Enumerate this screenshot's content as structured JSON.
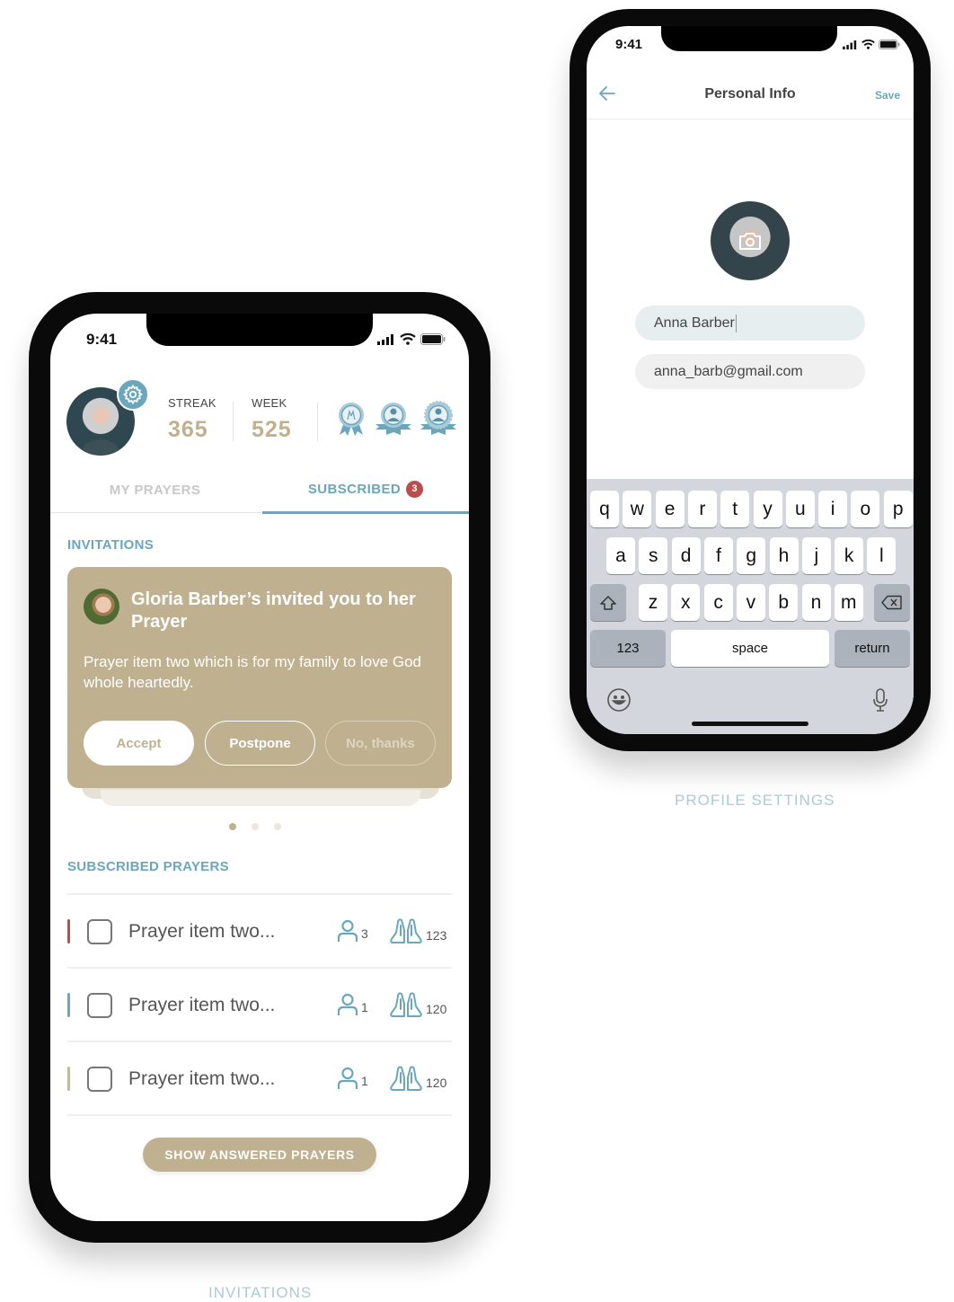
{
  "colors": {
    "accent": "#6aa7bd",
    "gold": "#bfb090",
    "badge_red": "#b84f4c"
  },
  "invitations_screen": {
    "caption": "INVITATIONS",
    "status": {
      "time": "9:41"
    },
    "profile": {
      "settings_icon": "gear-icon",
      "streak_label": "STREAK",
      "streak_value": "365",
      "week_label": "WEEK",
      "week_value": "525",
      "achievements": [
        "praying-hands-medal",
        "person-2-medal",
        "person-12-medal"
      ]
    },
    "tabs": [
      {
        "label": "MY PRAYERS",
        "active": false
      },
      {
        "label": "SUBSCRIBED",
        "active": true,
        "badge": "3"
      }
    ],
    "invitations": {
      "title": "INVITATIONS",
      "card": {
        "title": "Gloria Barber’s invited you to her Prayer",
        "body": "Prayer item two which is for my family to love God whole heartedly.",
        "accept": "Accept",
        "postpone": "Postpone",
        "decline": "No, thanks"
      },
      "pages": 3,
      "active_page": 1
    },
    "subscribed": {
      "title": "SUBSCRIBED PRAYERS",
      "items": [
        {
          "text": "Prayer item two...",
          "color": "#b84f4c",
          "people": "3",
          "prayers": "123",
          "checked": false
        },
        {
          "text": "Prayer item two...",
          "color": "#6aa7bd",
          "people": "1",
          "prayers": "120",
          "checked": false
        },
        {
          "text": "Prayer item two...",
          "color": "#c9b98f",
          "people": "1",
          "prayers": "120",
          "checked": false
        }
      ],
      "show_answered": "SHOW ANSWERED PRAYERS"
    }
  },
  "profile_screen": {
    "caption": "PROFILE SETTINGS",
    "status": {
      "time": "9:41"
    },
    "nav": {
      "title": "Personal Info",
      "save": "Save"
    },
    "fields": {
      "name": "Anna Barber",
      "email": "anna_barb@gmail.com"
    },
    "keyboard": {
      "row1": [
        "q",
        "w",
        "e",
        "r",
        "t",
        "y",
        "u",
        "i",
        "o",
        "p"
      ],
      "row2": [
        "a",
        "s",
        "d",
        "f",
        "g",
        "h",
        "j",
        "k",
        "l"
      ],
      "row3": [
        "z",
        "x",
        "c",
        "v",
        "b",
        "n",
        "m"
      ],
      "numbers": "123",
      "space": "space",
      "return": "return"
    }
  }
}
